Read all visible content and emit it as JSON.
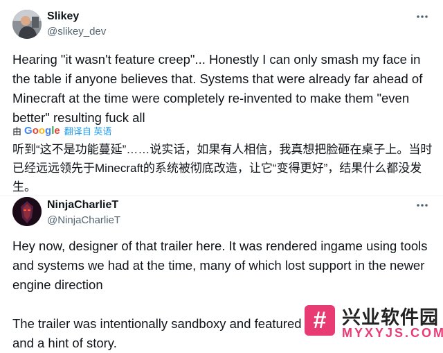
{
  "tweet1": {
    "author_name": "Slikey",
    "author_handle": "@slikey_dev",
    "more_icon": "more-horizontal-icon",
    "body": "Hearing \"it wasn't feature creep\"... Honestly I can only smash my face in the table if anyone believes that. Systems that were already far ahead of Minecraft at the time were completely re-invented to make them \"even better\" resulting fuck all",
    "translate_prefix": "由",
    "translate_provider": "Google",
    "translate_label": "翻译自 英语",
    "translation": "听到“这不是功能蔓延”……说实话，如果有人相信，我真想把脸砸在桌子上。当时已经远远领先于Minecraft的系统被彻底改造，让它“变得更好”，结果什么都没发生。"
  },
  "tweet2": {
    "author_name": "NinjaCharlieT",
    "author_handle": "@NinjaCharlieT",
    "more_icon": "more-horizontal-icon",
    "paragraph1": "Hey now, designer of that trailer here. It was rendered ingame using tools and systems we had at the time, many of which lost support in the newer engine direction",
    "paragraph2": "The trailer was intentionally sandboxy and featured worldgen, exploration and a hint of story."
  },
  "watermark": {
    "logo_glyph": "#",
    "name": "兴业软件园",
    "url": "MYXYJS.COM"
  },
  "colors": {
    "text": "#0f1419",
    "secondary": "#536471",
    "link": "#1d9bf0",
    "watermark_accent": "#e83b73"
  }
}
